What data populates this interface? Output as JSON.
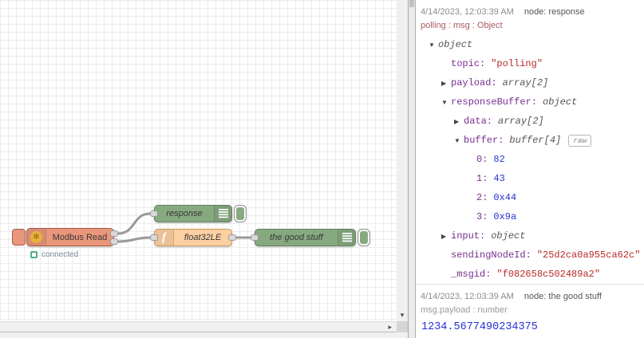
{
  "flow": {
    "nodes": {
      "modbus": {
        "label": "Modbus Read",
        "status": "connected",
        "color": "#e9967a",
        "icon": "modbus-flower",
        "icon_glyph": "✻"
      },
      "response": {
        "label": "response",
        "color": "#87a980"
      },
      "func": {
        "label": "float32LE",
        "color": "#fdd0a2",
        "icon_glyph": "f"
      },
      "good": {
        "label": "the good stuff",
        "color": "#87a980"
      }
    }
  },
  "debug": {
    "messages": [
      {
        "timestamp": "4/14/2023, 12:03:39 AM",
        "node": "node: response",
        "subject": "polling : msg : Object",
        "tree": [
          {
            "arrow": "▼",
            "key": "",
            "value": "object",
            "indent": 0,
            "vtype": "type"
          },
          {
            "arrow": "",
            "key": "topic:",
            "value": "\"polling\"",
            "indent": 1,
            "vtype": "string"
          },
          {
            "arrow": "▶",
            "key": "payload:",
            "value": "array[2]",
            "indent": 1,
            "vtype": "type"
          },
          {
            "arrow": "▼",
            "key": "responseBuffer:",
            "value": "object",
            "indent": 1,
            "vtype": "type"
          },
          {
            "arrow": "▶",
            "key": "data:",
            "value": "array[2]",
            "indent": 2,
            "vtype": "type"
          },
          {
            "arrow": "▼",
            "key": "buffer:",
            "value": "buffer[4]",
            "indent": 2,
            "vtype": "type",
            "raw_button": "raw"
          },
          {
            "arrow": "",
            "key": "0:",
            "value": "82",
            "indent": 3,
            "vtype": "number"
          },
          {
            "arrow": "",
            "key": "1:",
            "value": "43",
            "indent": 3,
            "vtype": "number"
          },
          {
            "arrow": "",
            "key": "2:",
            "value": "0x44",
            "indent": 3,
            "vtype": "number"
          },
          {
            "arrow": "",
            "key": "3:",
            "value": "0x9a",
            "indent": 3,
            "vtype": "number"
          },
          {
            "arrow": "▶",
            "key": "input:",
            "value": "object",
            "indent": 1,
            "vtype": "type"
          },
          {
            "arrow": "",
            "key": "sendingNodeId:",
            "value": "\"25d2ca0a955ca62c\"",
            "indent": 1,
            "vtype": "string"
          },
          {
            "arrow": "",
            "key": "_msgid:",
            "value": "\"f082658c502489a2\"",
            "indent": 1,
            "vtype": "string"
          }
        ]
      },
      {
        "timestamp": "4/14/2023, 12:03:39 AM",
        "node": "node: the good stuff",
        "subject": "msg.payload : number",
        "value": "1234.5677490234375"
      }
    ]
  },
  "ui": {
    "icons": {
      "scroll_down": "▾",
      "scroll_right": "▸"
    },
    "colors": {
      "key": "#792e90",
      "string": "#b72828",
      "number": "#2732d2",
      "subject_red": "#ab5a5f",
      "wire": "#999999",
      "status_green": "#55aa88"
    }
  }
}
